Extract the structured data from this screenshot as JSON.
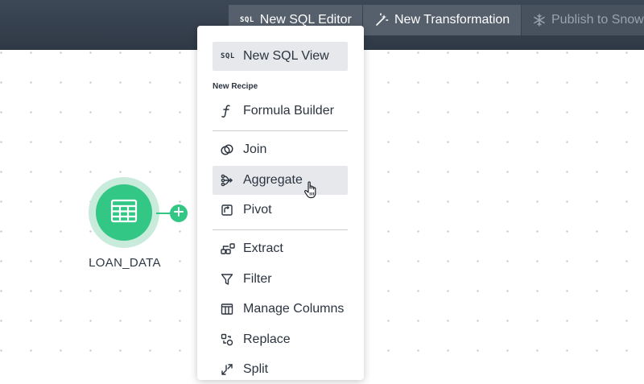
{
  "toolbar": {
    "sql_tag": "SQL",
    "new_sql_editor": "New SQL Editor",
    "new_transformation": "New Transformation",
    "publish_to_snowflake": "Publish to Snow"
  },
  "canvas": {
    "node_label": "LOAN_DATA"
  },
  "menu": {
    "sql_tag": "SQL",
    "new_sql_view": "New SQL View",
    "section_title": "New Recipe",
    "items": [
      {
        "label": "Formula Builder",
        "icon": "function-icon"
      },
      {
        "label": "Join",
        "icon": "join-icon"
      },
      {
        "label": "Aggregate",
        "icon": "aggregate-icon"
      },
      {
        "label": "Pivot",
        "icon": "pivot-icon"
      },
      {
        "label": "Extract",
        "icon": "extract-icon"
      },
      {
        "label": "Filter",
        "icon": "filter-icon"
      },
      {
        "label": "Manage Columns",
        "icon": "columns-icon"
      },
      {
        "label": "Replace",
        "icon": "replace-icon"
      },
      {
        "label": "Split",
        "icon": "split-icon"
      }
    ],
    "highlighted_item": "Aggregate"
  },
  "colors": {
    "topbar": "#2f3946",
    "node_green": "#32c785",
    "node_halo": "#c9ebdb",
    "menu_highlight": "#e6e8eb"
  }
}
